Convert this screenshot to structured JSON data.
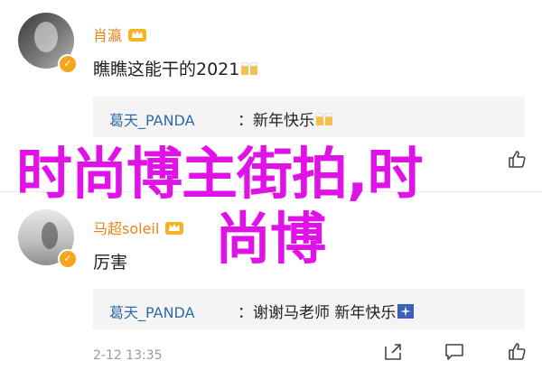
{
  "comments": [
    {
      "username": "肖瀛",
      "text": "瞧瞧这能干的2021",
      "reply": {
        "username": "葛天_PANDA",
        "text": "新年快乐"
      },
      "timestamp": "",
      "icons": [
        "crown-badge-icon",
        "beer-emoji-icon",
        "verified-badge-icon"
      ]
    },
    {
      "username": "马超soleil",
      "text": "厉害",
      "reply": {
        "username": "葛天_PANDA",
        "text": "谢谢马老师 新年快乐"
      },
      "timestamp": "2-12 13:35",
      "icons": [
        "crown-badge-icon",
        "sparkle-emoji-icon",
        "verified-badge-icon"
      ]
    }
  ],
  "actions": [
    "share-icon",
    "comment-icon",
    "like-icon"
  ],
  "overlay": {
    "line1": "时尚博主街拍,时",
    "line2": "尚博"
  },
  "colors": {
    "username": "#e4851a",
    "reply_username": "#2f6aa6",
    "overlay": "#e012e8",
    "reply_bg": "#f4f4f4"
  }
}
